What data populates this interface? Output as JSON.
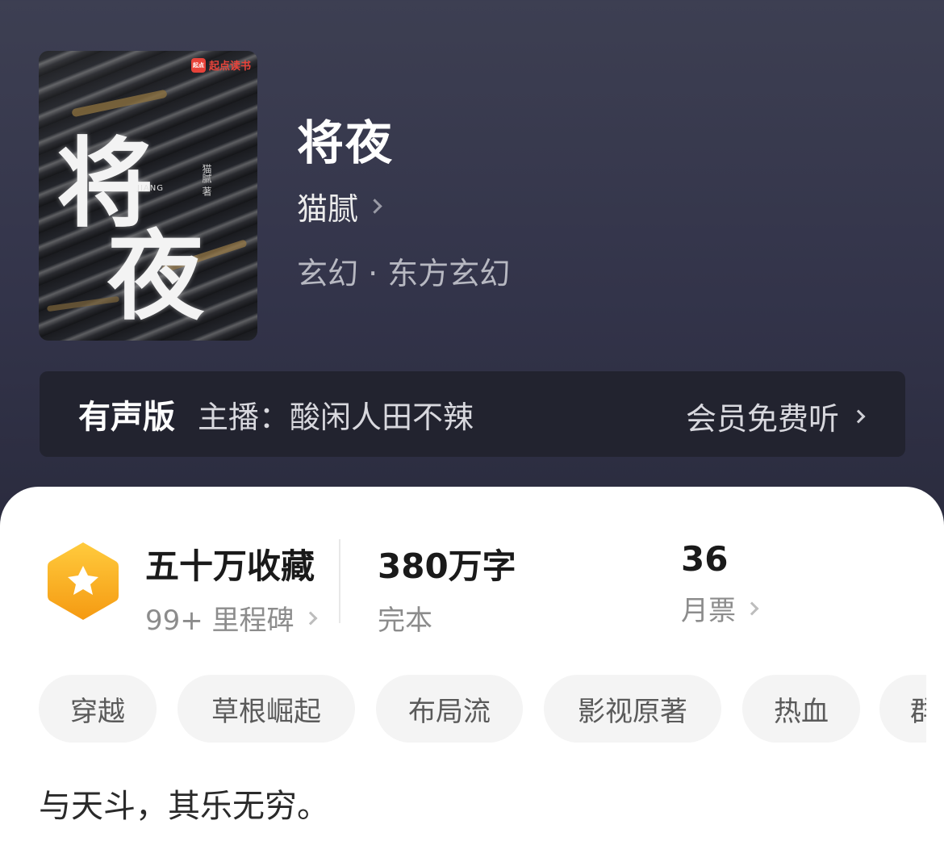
{
  "book": {
    "title": "将夜",
    "author": "猫腻",
    "genre": "玄幻 · 东方玄幻",
    "cover": {
      "glyph_top": "将",
      "glyph_bottom": "夜",
      "pinyin": "JIANG",
      "brand": "起点读书",
      "brand_logo": "起点",
      "author_mark": "猫腻 著"
    }
  },
  "audio": {
    "label": "有声版",
    "host": "主播：酸闲人田不辣",
    "action": "会员免费听"
  },
  "stats": {
    "collect_title": "五十万收藏",
    "collect_sub": "99+ 里程碑",
    "words_title": "380万字",
    "words_sub": "完本",
    "ticket_title": "36",
    "ticket_sub": "月票"
  },
  "tags": [
    "穿越",
    "草根崛起",
    "布局流",
    "影视原著",
    "热血",
    "群"
  ],
  "intro": "与天斗，其乐无穷。",
  "colors": {
    "hero_bg": "#33344a",
    "badge_orange": "#f6a21c",
    "white": "#ffffff"
  }
}
